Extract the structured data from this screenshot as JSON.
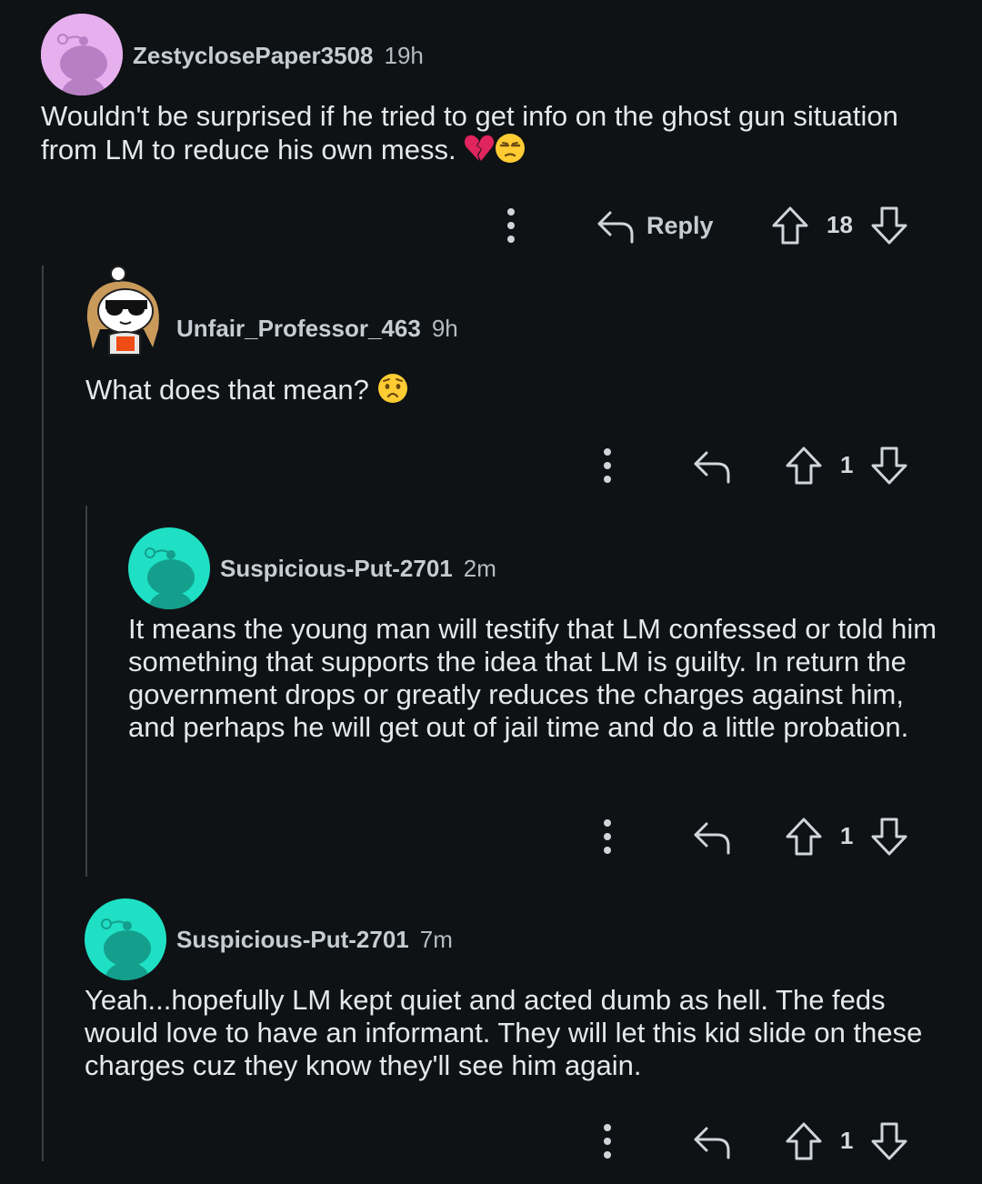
{
  "colors": {
    "background": "#0f1215",
    "thread_line": "#3a3f44",
    "text": "#e4e8eb",
    "meta": "#c6cdd2",
    "avatar_pink": "#e6b0ee",
    "avatar_teal": "#1fe0c4"
  },
  "comments": [
    {
      "username": "ZestyclosePaper3508",
      "time": "19h",
      "body": "Wouldn't be surprised if he tried to get info on the ghost gun situation from LM to reduce his own mess.",
      "emojis": [
        "broken-heart-emoji",
        "unamused-face-emoji"
      ],
      "reply_label": "Reply",
      "score": "18",
      "avatar": "snoo-default-pink"
    },
    {
      "username": "Unfair_Professor_463",
      "time": "9h",
      "body": "What does that mean?",
      "emojis": [
        "worried-face-emoji"
      ],
      "score": "1",
      "avatar": "snoo-custom-sunglasses"
    },
    {
      "username": "Suspicious-Put-2701",
      "time": "2m",
      "body": "It means the young man will testify that LM confessed or told him something that supports the idea that LM is guilty. In return the government drops or greatly reduces the charges against him, and perhaps he will get out of jail time and do a little probation.",
      "score": "1",
      "avatar": "snoo-default-teal"
    },
    {
      "username": "Suspicious-Put-2701",
      "time": "7m",
      "body": "Yeah...hopefully LM kept quiet and acted dumb as hell. The feds would love to have an informant. They will let this kid slide on these charges cuz they know they'll see him again.",
      "score": "1",
      "avatar": "snoo-default-teal"
    }
  ]
}
